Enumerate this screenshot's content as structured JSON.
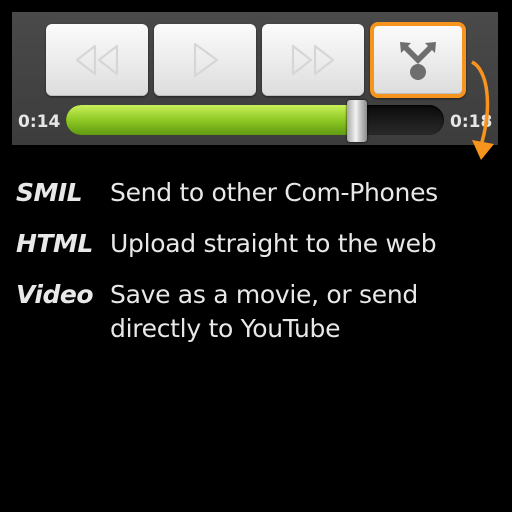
{
  "player": {
    "icons": [
      "rewind-icon",
      "play-icon",
      "fast-forward-icon",
      "share-icon"
    ],
    "elapsed": "0:14",
    "duration": "0:18",
    "progress": 0.77,
    "colors": {
      "highlight": "#f7941d",
      "seek_fill": "#8fc924"
    }
  },
  "legend": [
    {
      "key": "SMIL",
      "text": "Send to other Com-Phones"
    },
    {
      "key": "HTML",
      "text": "Upload straight to the web"
    },
    {
      "key": "Video",
      "text": "Save as a movie, or send directly to YouTube"
    }
  ]
}
